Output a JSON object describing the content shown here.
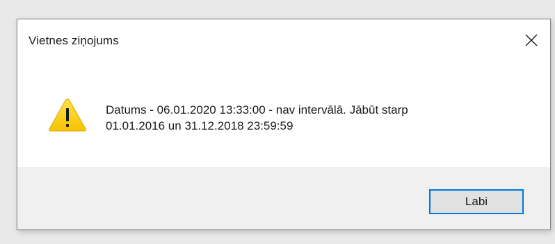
{
  "dialog": {
    "title": "Vietnes ziņojums",
    "close_icon": "close-icon",
    "warning_icon": "warning-icon",
    "message_line1": "Datums - 06.01.2020 13:33:00 - nav intervālā. Jābūt starp",
    "message_line2": "01.01.2016 un 31.12.2018 23:59:59",
    "ok_label": "Labi",
    "colors": {
      "accent": "#0078d7",
      "warning_fill": "#fcd116",
      "footer_bg": "#f0f0f0"
    }
  }
}
